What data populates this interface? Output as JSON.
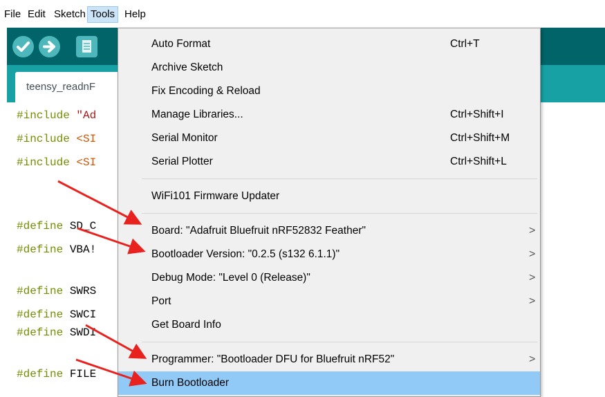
{
  "menubar": {
    "file": "File",
    "edit": "Edit",
    "sketch": "Sketch",
    "tools": "Tools",
    "help": "Help"
  },
  "toolbar": {
    "verify_icon": "check-icon",
    "upload_icon": "arrow-right-icon",
    "new_icon": "document-icon"
  },
  "tab": {
    "label": "teensy_readnF"
  },
  "editor": {
    "lines": [
      {
        "kw": "#include ",
        "arg": "\"Ad",
        "argtype": "str"
      },
      {
        "kw": "#include ",
        "arg": "<SI",
        "argtype": "lib"
      },
      {
        "kw": "#include ",
        "arg": "<SI",
        "argtype": "lib"
      },
      {
        "kw": "#define ",
        "arg": "SD_C",
        "argtype": "plain"
      },
      {
        "kw": "#define ",
        "arg": "VBA!",
        "argtype": "plain"
      },
      {
        "kw": "#define ",
        "arg": "SWRS",
        "argtype": "plain"
      },
      {
        "kw": "#define ",
        "arg": "SWCI",
        "argtype": "plain"
      },
      {
        "kw": "#define ",
        "arg": "SWDI",
        "argtype": "plain"
      },
      {
        "kw": "#define ",
        "arg": "FILE",
        "argtype": "plain"
      }
    ]
  },
  "tools_menu": {
    "items": [
      {
        "label": "Auto Format",
        "shortcut": "Ctrl+T"
      },
      {
        "label": "Archive Sketch",
        "shortcut": ""
      },
      {
        "label": "Fix Encoding & Reload",
        "shortcut": ""
      },
      {
        "label": "Manage Libraries...",
        "shortcut": "Ctrl+Shift+I"
      },
      {
        "label": "Serial Monitor",
        "shortcut": "Ctrl+Shift+M"
      },
      {
        "label": "Serial Plotter",
        "shortcut": "Ctrl+Shift+L"
      },
      {
        "label": "WiFi101 Firmware Updater",
        "shortcut": ""
      },
      {
        "label": "Board: \"Adafruit Bluefruit nRF52832 Feather\"",
        "submenu": ">"
      },
      {
        "label": "Bootloader Version: \"0.2.5 (s132 6.1.1)\"",
        "submenu": ">"
      },
      {
        "label": "Debug Mode: \"Level 0 (Release)\"",
        "submenu": ">"
      },
      {
        "label": "Port",
        "submenu": ">"
      },
      {
        "label": "Get Board Info"
      },
      {
        "label": "Programmer: \"Bootloader DFU for Bluefruit nRF52\"",
        "submenu": ">"
      },
      {
        "label": "Burn Bootloader"
      }
    ]
  },
  "colors": {
    "toolbar_bg": "#006468",
    "tab_strip_bg": "#17a1a5",
    "button": "#4db7bb",
    "highlight": "#91c9f7",
    "annotation_arrow": "#e8231f"
  }
}
